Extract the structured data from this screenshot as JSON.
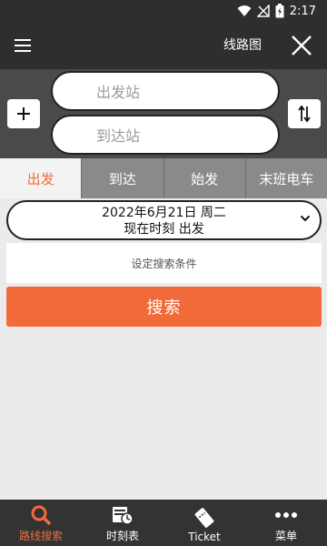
{
  "status_bar": {
    "time": "2:17"
  },
  "toolbar": {
    "route_map_label": "线路图"
  },
  "stations": {
    "from_placeholder": "出发站",
    "to_placeholder": "到达站"
  },
  "tabs": [
    {
      "label": "出发",
      "active": true
    },
    {
      "label": "到达",
      "active": false
    },
    {
      "label": "始发",
      "active": false
    },
    {
      "label": "末班电车",
      "active": false
    }
  ],
  "date_select": {
    "date": "2022年6月21日 周二",
    "mode": "现在时刻 出发"
  },
  "conditions_label": "设定搜索条件",
  "search_label": "搜索",
  "bottom_nav": [
    {
      "label": "路线搜索",
      "icon": "search-icon",
      "active": true
    },
    {
      "label": "时刻表",
      "icon": "timetable-icon",
      "active": false
    },
    {
      "label": "Ticket",
      "icon": "ticket-icon",
      "active": false
    },
    {
      "label": "菜单",
      "icon": "more-icon",
      "active": false
    }
  ],
  "colors": {
    "accent": "#f26a3a",
    "dark_bar": "#2e2e2e",
    "panel": "#4a4a4a",
    "tab_inactive": "#8a8a8a"
  }
}
